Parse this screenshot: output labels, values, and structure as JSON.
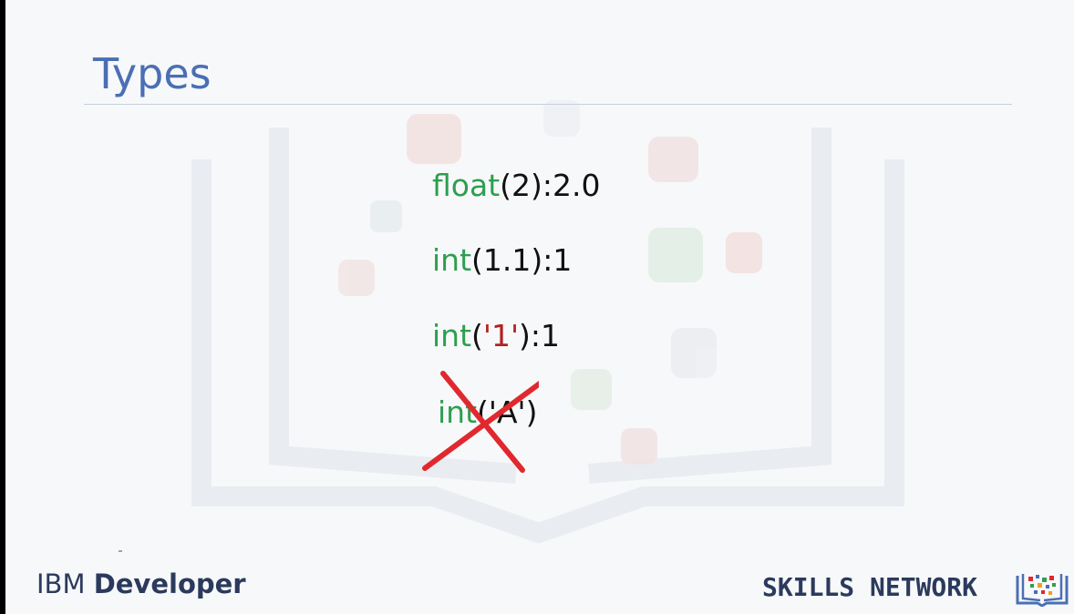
{
  "slide": {
    "title": "Types",
    "examples": [
      {
        "fn": "int",
        "open": "(",
        "arg": "",
        "close": ""
      },
      {
        "fn": "float",
        "rest": "(2):2.0"
      },
      {
        "fn": "int",
        "rest": "(1.1):1"
      },
      {
        "fn": "int",
        "open": "(",
        "str": "'1'",
        "rest": "):1"
      },
      {
        "fn": "int",
        "rest": "('A')",
        "crossed_out": true
      }
    ]
  },
  "footer": {
    "left_brand_light": "IBM",
    "left_brand_bold": "Developer",
    "right_brand": "SKILLS NETWORK"
  },
  "colors": {
    "title": "#4a6fb3",
    "function_name": "#2e9e4f",
    "string_literal": "#b22222",
    "cross": "#e0282e"
  },
  "icons": {
    "cross": "x-mark-icon",
    "skills_network": "skills-network-logo"
  }
}
